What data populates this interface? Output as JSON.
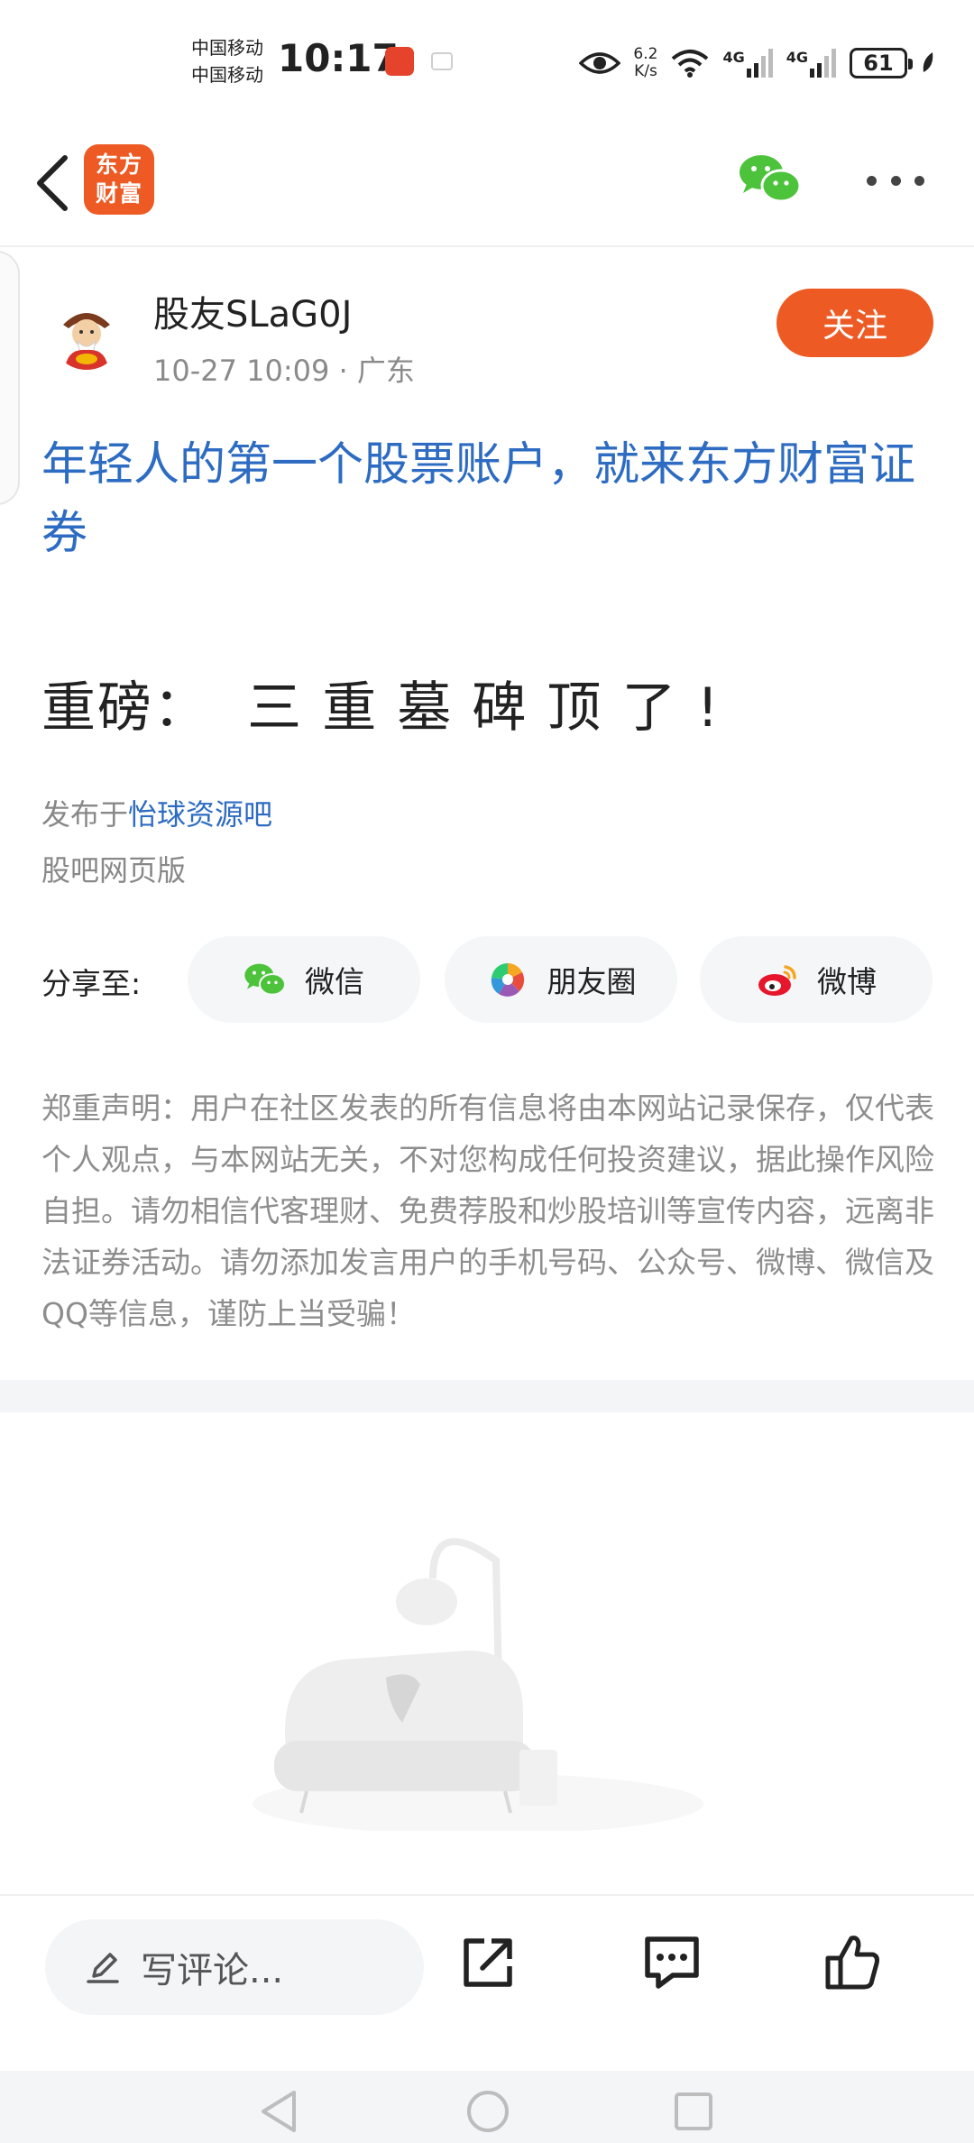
{
  "status_bar": {
    "carrier_1": "中国移动",
    "carrier_2": "中国移动",
    "time": "10:17",
    "speed_value": "6.2",
    "speed_unit": "K/s",
    "net_1": "4G",
    "net_2": "4G",
    "battery": "61"
  },
  "nav": {
    "logo_line1": "东方",
    "logo_line2": "财富",
    "icons": [
      "back-arrow-icon",
      "wechat-icon",
      "more-icon"
    ]
  },
  "author": {
    "name": "股友SLaG0J",
    "meta": "10-27 10:09 · 广东",
    "follow_label": "关注"
  },
  "post": {
    "promo_link": "年轻人的第一个股票账户，就来东方财富证券",
    "title": "重磅：  三 重 墓 碑 顶 了 !",
    "published_prefix": "发布于",
    "bar_name": "怡球资源吧",
    "source": "股吧网页版"
  },
  "share": {
    "label": "分享至:",
    "wechat": "微信",
    "moments": "朋友圈",
    "weibo": "微博"
  },
  "disclaimer": "郑重声明：用户在社区发表的所有信息将由本网站记录保存，仅代表个人观点，与本网站无关，不对您构成任何投资建议，据此操作风险自担。请勿相信代客理财、免费荐股和炒股培训等宣传内容，远离非法证券活动。请勿添加发言用户的手机号码、公众号、微博、微信及QQ等信息，谨防上当受骗！",
  "action_bar": {
    "comment_placeholder": "写评论...",
    "icons": [
      "edit-icon",
      "share-out-icon",
      "comment-icon",
      "like-icon"
    ]
  },
  "colors": {
    "brand_orange": "#ee5a24",
    "link_blue": "#2d6cc2",
    "wechat_green": "#4cc33b"
  }
}
